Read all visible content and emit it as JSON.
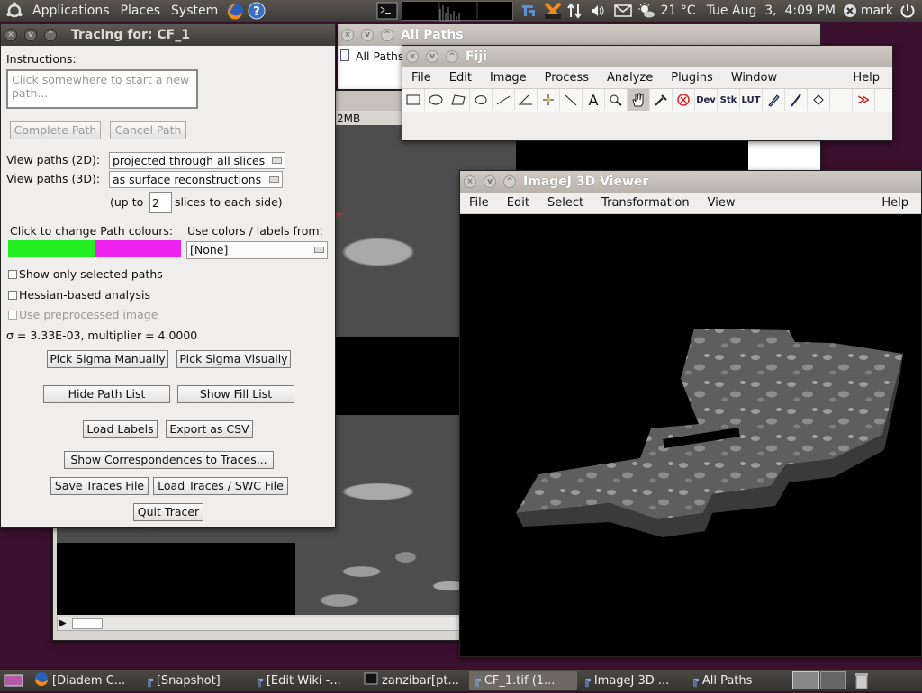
{
  "top_panel": {
    "menus": [
      "Applications",
      "Places",
      "System"
    ],
    "temperature": "21 °C",
    "datetime": "Tue Aug  3,  4:09 PM",
    "user": "mark"
  },
  "all_paths_window": {
    "title": "All Paths",
    "root_item": "All Paths"
  },
  "image_window": {
    "size_text": "2MB"
  },
  "tracer": {
    "title": "Tracing for: CF_1",
    "instructions_label": "Instructions:",
    "instructions_text": "Click somewhere to start a new path...",
    "complete_path": "Complete Path",
    "cancel_path": "Cancel Path",
    "view2d_label": "View paths (2D):",
    "view2d_value": "projected through all slices",
    "view3d_label": "View paths (3D):",
    "view3d_value": "as surface reconstructions",
    "upto_label": "(up to",
    "upto_value": "2",
    "slices_label": "slices to each side)",
    "colours_label": "Click to change Path colours:",
    "colours": [
      "#22ee22",
      "#ee22ee"
    ],
    "use_colors_label": "Use colors / labels from:",
    "use_colors_value": "[None]",
    "show_selected": "Show only selected paths",
    "hessian": "Hessian-based analysis",
    "preprocessed": "Use preprocessed image",
    "sigma_text": "σ = 3.33E-03, multiplier = 4.0000",
    "pick_sigma_manually": "Pick Sigma Manually",
    "pick_sigma_visually": "Pick Sigma Visually",
    "hide_path_list": "Hide Path List",
    "show_fill_list": "Show Fill List",
    "load_labels": "Load Labels",
    "export_csv": "Export as CSV",
    "show_correspondences": "Show Correspondences to Traces...",
    "save_traces": "Save Traces File",
    "load_traces": "Load Traces / SWC File",
    "quit_tracer": "Quit Tracer"
  },
  "fiji": {
    "title": "Fiji",
    "menus": [
      "File",
      "Edit",
      "Image",
      "Process",
      "Analyze",
      "Plugins",
      "Window"
    ],
    "help": "Help",
    "tools": [
      "rectangle-tool",
      "oval-tool",
      "polygon-tool",
      "freehand-tool",
      "line-tool",
      "angle-tool",
      "point-tool",
      "wand-tool",
      "text-tool",
      "magnifier-tool",
      "hand-tool",
      "color-picker-tool",
      "stop-tool",
      "dev-tool",
      "stk-tool",
      "lut-tool",
      "pencil-tool",
      "brush-tool",
      "flood-fill-tool",
      "blank-tool",
      "more-tools"
    ],
    "tool_labels": {
      "dev": "Dev",
      "stk": "Stk",
      "lut": "LUT",
      "text": "A",
      "more": "≫"
    }
  },
  "viewer3d": {
    "title": "ImageJ 3D Viewer",
    "menus": [
      "File",
      "Edit",
      "Select",
      "Transformation",
      "View"
    ],
    "help": "Help"
  },
  "taskbar": {
    "items": [
      "[Diadem C...",
      "[Snapshot]",
      "[Edit Wiki -...",
      "zanzibar[pt...",
      "CF_1.tif (1...",
      "ImageJ 3D ...",
      "All Paths"
    ]
  },
  "colors": {
    "panel": "#3c3a36",
    "desktop": "#3b0f2e",
    "window_bg": "#efeeec"
  }
}
